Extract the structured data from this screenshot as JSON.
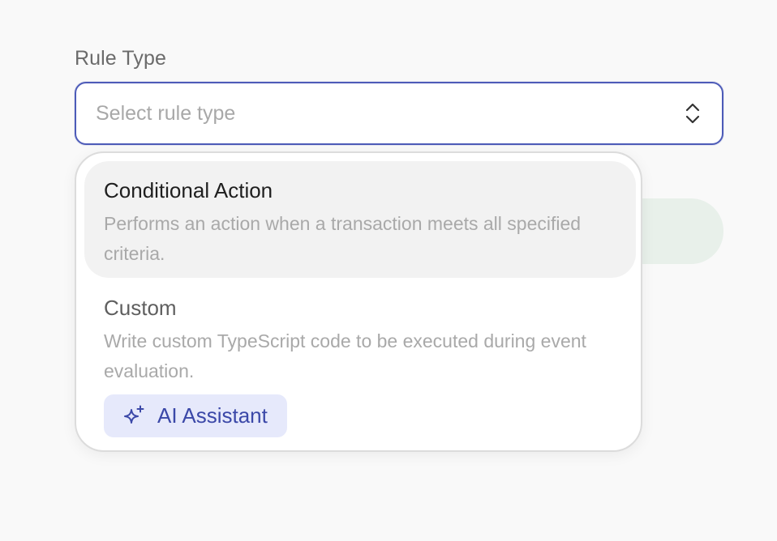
{
  "field": {
    "label": "Rule Type",
    "placeholder": "Select rule type"
  },
  "dropdown": {
    "options": [
      {
        "title": "Conditional Action",
        "description": "Performs an action when a transaction meets all specified criteria."
      },
      {
        "title": "Custom",
        "description": "Write custom TypeScript code to be executed during event evaluation."
      }
    ],
    "ai_button_label": "AI Assistant"
  },
  "colors": {
    "accent": "#4d5bb8",
    "ai_badge_bg": "#e6e9fb",
    "ai_badge_text": "#3b48a8"
  },
  "icons": {
    "select_chevrons": "chevrons-up-down-icon",
    "ai": "sparkle-icon"
  }
}
